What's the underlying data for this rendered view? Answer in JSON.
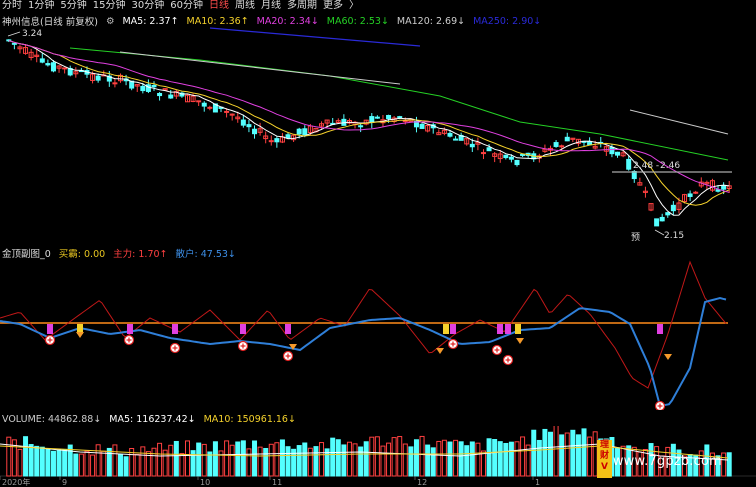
{
  "toolbar": {
    "periods": [
      "分时",
      "1分钟",
      "5分钟",
      "15分钟",
      "30分钟",
      "60分钟",
      "日线",
      "周线",
      "月线",
      "多周期",
      "更多"
    ],
    "active_period": "日线",
    "more_arrow": "〉"
  },
  "main_chart": {
    "stock_title": "神州信息(日线 前复权)",
    "ma_items": [
      {
        "label": "MA5: 2.37",
        "arrow": "↑",
        "color": "#ffffff"
      },
      {
        "label": "MA10: 2.36",
        "arrow": "↑",
        "color": "#f5d22c"
      },
      {
        "label": "MA20: 2.34",
        "arrow": "↓",
        "color": "#e040e0"
      },
      {
        "label": "MA60: 2.53",
        "arrow": "↓",
        "color": "#25d025"
      },
      {
        "label": "MA120: 2.69",
        "arrow": "↓",
        "color": "#cccccc"
      },
      {
        "label": "MA250: 2.90",
        "arrow": "↓",
        "color": "#2a2ad8"
      }
    ],
    "annotations": {
      "high": "3.24",
      "mid_left": "2.48",
      "mid_right": "2.46",
      "low": "2.15",
      "marker": "预"
    }
  },
  "indicator_chart": {
    "title": "金顶副图_0",
    "items": [
      {
        "label": "买霸: 0.00",
        "color": "#e6c420"
      },
      {
        "label": "主力: 1.70",
        "arrow": "↑",
        "color": "#ff4040"
      },
      {
        "label": "散户: 47.53",
        "arrow": "↓",
        "color": "#3d8fe8"
      }
    ]
  },
  "volume_chart": {
    "items": [
      {
        "label": "VOLUME: 44862.88",
        "arrow": "↓",
        "color": "#cccccc"
      },
      {
        "label": "MA5: 116237.42",
        "arrow": "↓",
        "color": "#ffffff"
      },
      {
        "label": "MA10: 150961.16",
        "arrow": "↓",
        "color": "#f5d22c"
      }
    ],
    "x_labels": [
      "2020年",
      "9",
      "10",
      "11",
      "12",
      "1"
    ]
  },
  "colors": {
    "up": "#ff4040",
    "down": "#54ffff",
    "orange_line": "#ff8c1a",
    "blue_line": "#2f7fd8",
    "red_line": "#c01818"
  },
  "watermark": "www.7gpzb.com",
  "ad_badge": "理财V"
}
